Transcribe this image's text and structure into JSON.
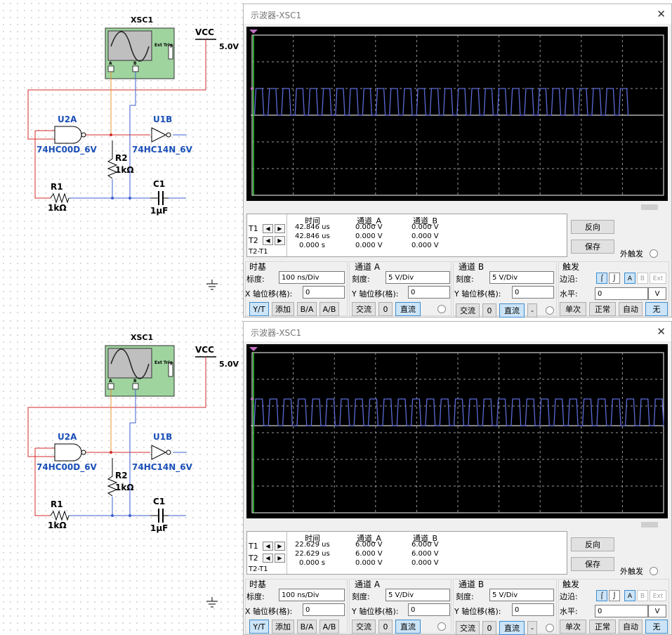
{
  "panels": [
    {
      "circuit": {
        "instrument_label": "XSC1",
        "ext_trig_label": "Ext Trig",
        "probe_a": "A",
        "probe_b": "B",
        "vcc_label": "VCC",
        "vcc_value": "5.0V",
        "gate1_ref": "U2A",
        "gate1_part": "74HC00D_6V",
        "gate2_ref": "U1B",
        "gate2_part": "74HC14N_6V",
        "r2_ref": "R2",
        "r2_value": "1kΩ",
        "r1_ref": "R1",
        "r1_value": "1kΩ",
        "c1_ref": "C1",
        "c1_value": "1µF"
      },
      "window": {
        "title": "示波器-XSC1",
        "close_glyph": "✕",
        "hdr_time": "时间",
        "hdr_cha": "通道_A",
        "hdr_chb": "通道_B",
        "t1_label": "T1",
        "t2_label": "T2",
        "t2t1_label": "T2-T1",
        "t1_time": "42.846 us",
        "t2_time": "42.846 us",
        "dt_time": "0.000 s",
        "t1_a": "0.000 V",
        "t2_a": "0.000 V",
        "dt_a": "0.000 V",
        "t1_b": "0.000 V",
        "t2_b": "0.000 V",
        "dt_b": "0.000 V",
        "reverse_btn": "反向",
        "save_btn": "保存",
        "ext_trigger_label": "外触发",
        "timebase_title": "时基",
        "scale_label": "标度:",
        "timebase_value": "100 ns/Div",
        "x_offset_label": "X 轴位移(格):",
        "x_offset_value": "0",
        "yt_btn": "Y/T",
        "add_btn": "添加",
        "ba_btn": "B/A",
        "ab_btn": "A/B",
        "cha_title": "通道 A",
        "cha_scale_label": "刻度:",
        "cha_scale": "5  V/Div",
        "y_offset_label": "Y 轴位移(格):",
        "cha_offset": "0",
        "ac_btn": "交流",
        "zero_btn": "0",
        "dc_btn": "直流",
        "chb_title": "通道 B",
        "chb_scale": "5  V/Div",
        "chb_offset": "0",
        "minus_btn": "-",
        "trigger_title": "触发",
        "edge_label": "边沿:",
        "src_a": "A",
        "src_b": "B",
        "src_ext": "Ext",
        "level_label": "水平:",
        "level_value": "0",
        "level_unit": "V",
        "single_btn": "单次",
        "normal_btn": "正常",
        "auto_btn": "自动",
        "none_btn": "无"
      },
      "waveform": {
        "high_div": 1.0,
        "low_div": 0.0,
        "period_div": 0.328,
        "duty": 0.58,
        "start_div": 0.06,
        "end_div": 9.15
      }
    },
    {
      "circuit": {
        "instrument_label": "XSC1",
        "ext_trig_label": "Ext Trig",
        "probe_a": "A",
        "probe_b": "B",
        "vcc_label": "VCC",
        "vcc_value": "5.0V",
        "gate1_ref": "U2A",
        "gate1_part": "74HC00D_6V",
        "gate2_ref": "U1B",
        "gate2_part": "74HC14N_6V",
        "r2_ref": "R2",
        "r2_value": "1kΩ",
        "r1_ref": "R1",
        "r1_value": "1kΩ",
        "c1_ref": "C1",
        "c1_value": "1µF"
      },
      "window": {
        "title": "示波器-XSC1",
        "close_glyph": "✕",
        "hdr_time": "时间",
        "hdr_cha": "通道_A",
        "hdr_chb": "通道_B",
        "t1_label": "T1",
        "t2_label": "T2",
        "t2t1_label": "T2-T1",
        "t1_time": "22.629 us",
        "t2_time": "22.629 us",
        "dt_time": "0.000 s",
        "t1_a": "6.000 V",
        "t2_a": "6.000 V",
        "dt_a": "0.000 V",
        "t1_b": "6.000 V",
        "t2_b": "6.000 V",
        "dt_b": "0.000 V",
        "reverse_btn": "反向",
        "save_btn": "保存",
        "ext_trigger_label": "外触发",
        "timebase_title": "时基",
        "scale_label": "标度:",
        "timebase_value": "100 ns/Div",
        "x_offset_label": "X 轴位移(格):",
        "x_offset_value": "0",
        "yt_btn": "Y/T",
        "add_btn": "添加",
        "ba_btn": "B/A",
        "ab_btn": "A/B",
        "cha_title": "通道 A",
        "cha_scale_label": "刻度:",
        "cha_scale": "5  V/Div",
        "y_offset_label": "Y 轴位移(格):",
        "cha_offset": "0",
        "ac_btn": "交流",
        "zero_btn": "0",
        "dc_btn": "直流",
        "chb_title": "通道 B",
        "chb_scale": "5  V/Div",
        "chb_offset": "0",
        "minus_btn": "-",
        "trigger_title": "触发",
        "edge_label": "边沿:",
        "src_a": "A",
        "src_b": "B",
        "src_ext": "Ext",
        "level_label": "水平:",
        "level_value": "0",
        "level_unit": "V",
        "single_btn": "单次",
        "normal_btn": "正常",
        "auto_btn": "自动",
        "none_btn": "无"
      },
      "waveform": {
        "high_div": 1.0,
        "low_div": 0.0,
        "period_div": 0.347,
        "duty": 0.58,
        "start_div": 0.05,
        "end_div": 10.0
      }
    }
  ],
  "colors": {
    "wire_red": "#d42a2a",
    "wire_blue": "#3b5fcf",
    "wire_orange": "#e8902a",
    "part_blue": "#1a4fb8",
    "trace": "#5c6bd8",
    "instrument_green": "#9fd49f"
  }
}
